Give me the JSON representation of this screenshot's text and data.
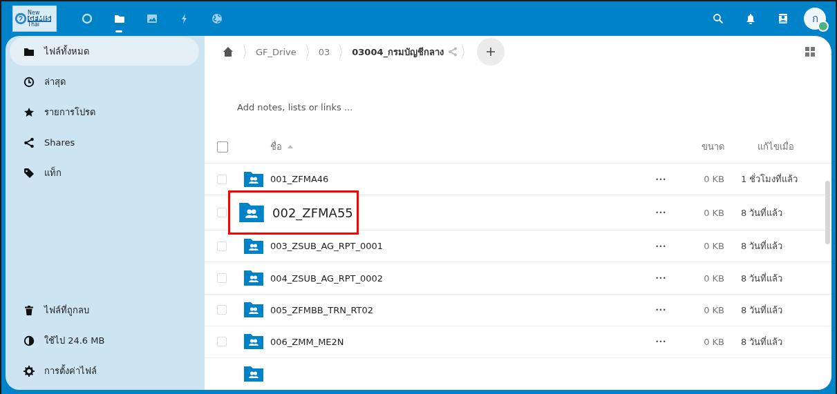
{
  "header": {
    "logo": {
      "texts": [
        "New",
        "GFMIS",
        "Thai"
      ]
    },
    "apps": [
      {
        "kind": "dashboard",
        "selected": false
      },
      {
        "kind": "files",
        "selected": true
      },
      {
        "kind": "photos",
        "selected": false
      },
      {
        "kind": "activity",
        "selected": false
      },
      {
        "kind": "globe",
        "selected": false
      }
    ],
    "actions": [
      {
        "kind": "search"
      },
      {
        "kind": "notifications"
      },
      {
        "kind": "contacts"
      }
    ],
    "avatar": {
      "initial": "ก",
      "online": true
    }
  },
  "sidebar": {
    "items": [
      {
        "label": "ไฟล์ทั้งหมด",
        "kind": "folder",
        "selected": true
      },
      {
        "label": "ล่าสุด",
        "kind": "clock",
        "selected": false
      },
      {
        "label": "รายการโปรด",
        "kind": "star",
        "selected": false
      },
      {
        "label": "Shares",
        "kind": "share",
        "selected": false
      },
      {
        "label": "แท็ก",
        "kind": "tag",
        "selected": false
      }
    ],
    "footer": [
      {
        "label": "ไฟล์ที่ถูกลบ",
        "kind": "trash"
      },
      {
        "label": "ใช้ไป 24.6 MB",
        "kind": "quota"
      },
      {
        "label": "การตั้งค่าไฟล์",
        "kind": "gear"
      }
    ]
  },
  "breadcrumbs": [
    {
      "label": "GF_Drive",
      "current": false
    },
    {
      "label": "03",
      "current": false
    },
    {
      "label": "03004_กรมบัญชีกลาง",
      "current": true
    }
  ],
  "notes": {
    "placeholder": "Add notes, lists or links ..."
  },
  "table": {
    "select_all": {
      "checked": false
    },
    "columns": [
      "ชื่อ",
      "ขนาด",
      "แก้ไขเมื่อ"
    ],
    "rows": [
      {
        "name": "001_ZFMA46",
        "actions": "•••",
        "size": "0 KB",
        "modified": "1 ชั่วโมงที่แล้ว",
        "checked": false,
        "highlighted": false
      },
      {
        "name": "002_ZFMA55",
        "actions": "•••",
        "size": "0 KB",
        "modified": "8 วันที่แล้ว",
        "checked": false,
        "highlighted": true
      },
      {
        "name": "003_ZSUB_AG_RPT_0001",
        "actions": "•••",
        "size": "0 KB",
        "modified": "8 วันที่แล้ว",
        "checked": false,
        "highlighted": false
      },
      {
        "name": "004_ZSUB_AG_RPT_0002",
        "actions": "•••",
        "size": "0 KB",
        "modified": "8 วันที่แล้ว",
        "checked": false,
        "highlighted": false
      },
      {
        "name": "005_ZFMBB_TRN_RT02",
        "actions": "•••",
        "size": "0 KB",
        "modified": "8 วันที่แล้ว",
        "checked": false,
        "highlighted": false
      },
      {
        "name": "006_ZMM_ME2N",
        "actions": "•••",
        "size": "0 KB",
        "modified": "8 วันที่แล้ว",
        "checked": false,
        "highlighted": false
      }
    ]
  }
}
